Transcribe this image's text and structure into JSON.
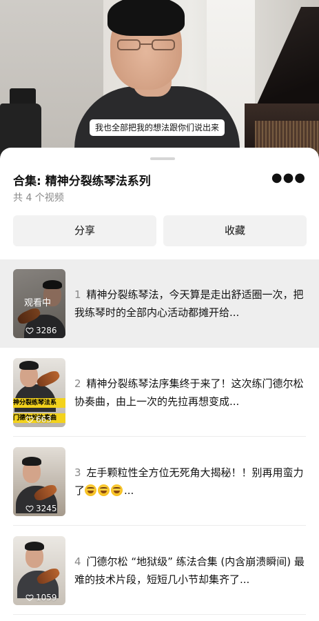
{
  "video": {
    "subtitle": "我也全部把我的想法跟你们说出来"
  },
  "collection": {
    "title": "合集: 精神分裂练琴法系列",
    "count_text": "共 4 个视频",
    "more_icon": "more-horizontal-icon",
    "share_label": "分享",
    "favorite_label": "收藏"
  },
  "items": [
    {
      "index": "1",
      "text": "精神分裂练琴法，今天算是走出舒适圈一次，把我练琴时的全部内心活动都摊开给...",
      "likes": "3286",
      "overlay": "观看中",
      "active": true
    },
    {
      "index": "2",
      "text": "精神分裂练琴法序集终于来了！这次练门德尔松协奏曲，由上一次的先拉再想变成...",
      "likes": "663",
      "banner_top": "神分裂练琴法系",
      "banner_bottom": "门德尔松协奏曲",
      "active": false
    },
    {
      "index": "3",
      "text": "左手颗粒性全方位无死角大揭秘！！别再用蛮力了",
      "likes": "3245",
      "active": false
    },
    {
      "index": "4",
      "text": "门德尔松 “地狱级” 练法合集 (内含崩溃瞬间) 最难的技术片段，短短几小节却集齐了...",
      "likes": "1059",
      "active": false
    }
  ],
  "colors": {
    "active_row": "#eeeeee",
    "button_bg": "#f2f2f2",
    "muted_text": "#888888",
    "banner_yellow": "#f3d21c"
  }
}
